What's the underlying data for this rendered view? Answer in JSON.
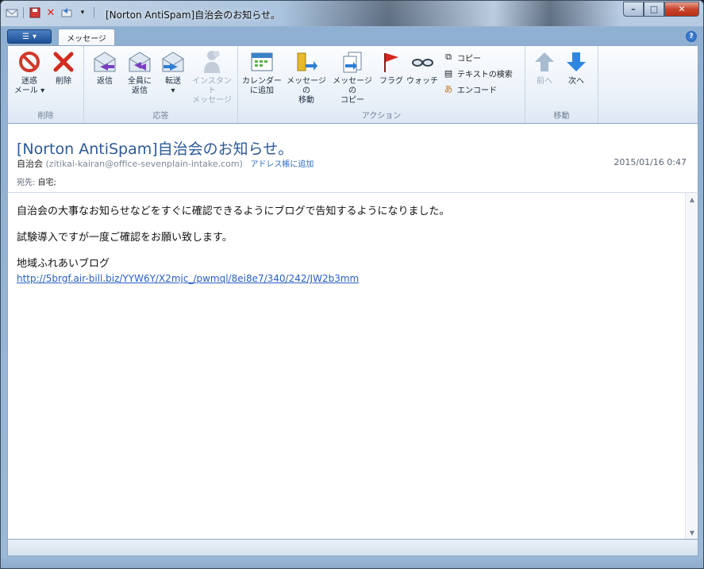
{
  "window": {
    "title": "[Norton AntiSpam]自治会のお知らせ。",
    "controls": {
      "minimize": "–",
      "maximize": "□",
      "close": "✕"
    }
  },
  "ribbon": {
    "tab": "メッセージ",
    "groups": {
      "delete": {
        "label": "削除",
        "buttons": [
          {
            "line1": "迷惑",
            "line2": "メール ▾",
            "icon": "junk-mail-icon"
          },
          {
            "line1": "削除",
            "line2": "",
            "icon": "delete-x-icon"
          }
        ]
      },
      "respond": {
        "label": "応答",
        "buttons": [
          {
            "line1": "返信",
            "line2": "",
            "icon": "reply-icon"
          },
          {
            "line1": "全員に",
            "line2": "返信",
            "icon": "reply-all-icon"
          },
          {
            "line1": "転送",
            "line2": "▾",
            "icon": "forward-icon"
          },
          {
            "line1": "インスタント",
            "line2": "メッセージ",
            "icon": "instant-message-icon"
          }
        ]
      },
      "actions": {
        "label": "アクション",
        "buttons": [
          {
            "line1": "カレンダー",
            "line2": "に追加",
            "icon": "calendar-icon"
          },
          {
            "line1": "メッセージの",
            "line2": "移動",
            "icon": "move-message-icon"
          },
          {
            "line1": "メッセージの",
            "line2": "コピー",
            "icon": "copy-message-icon"
          },
          {
            "line1": "フラグ",
            "line2": "",
            "icon": "flag-icon"
          },
          {
            "line1": "ウォッチ",
            "line2": "",
            "icon": "watch-glasses-icon"
          }
        ],
        "small": [
          {
            "label": "コピー",
            "icon": "copy-icon"
          },
          {
            "label": "テキストの検索",
            "icon": "find-text-icon"
          },
          {
            "label": "エンコード",
            "icon": "encode-icon"
          }
        ]
      },
      "move": {
        "label": "移動",
        "buttons": [
          {
            "line1": "前へ",
            "line2": "",
            "icon": "up-arrow-icon"
          },
          {
            "line1": "次へ",
            "line2": "",
            "icon": "down-arrow-icon"
          }
        ]
      }
    }
  },
  "message": {
    "subject": "[Norton AntiSpam]自治会のお知らせ。",
    "from_name": "自治会",
    "from_address": "(zitikai-kairan@office-sevenplain-intake.com)",
    "add_contact": "アドレス帳に追加",
    "date": "2015/01/16 0:47",
    "to_label": "宛先:",
    "to_value": "自宅;",
    "body": {
      "line1": "自治会の大事なお知らせなどをすぐに確認できるようにブログで告知するようになりました。",
      "line2": "試験導入ですが一度ご確認をお願い致します。",
      "line3": "地域ふれあいブログ",
      "link": "http://5brgf.air-bill.biz/YYW6Y/X2mjc_/pwmql/8ei8e7/340/242/JW2b3mm"
    }
  }
}
